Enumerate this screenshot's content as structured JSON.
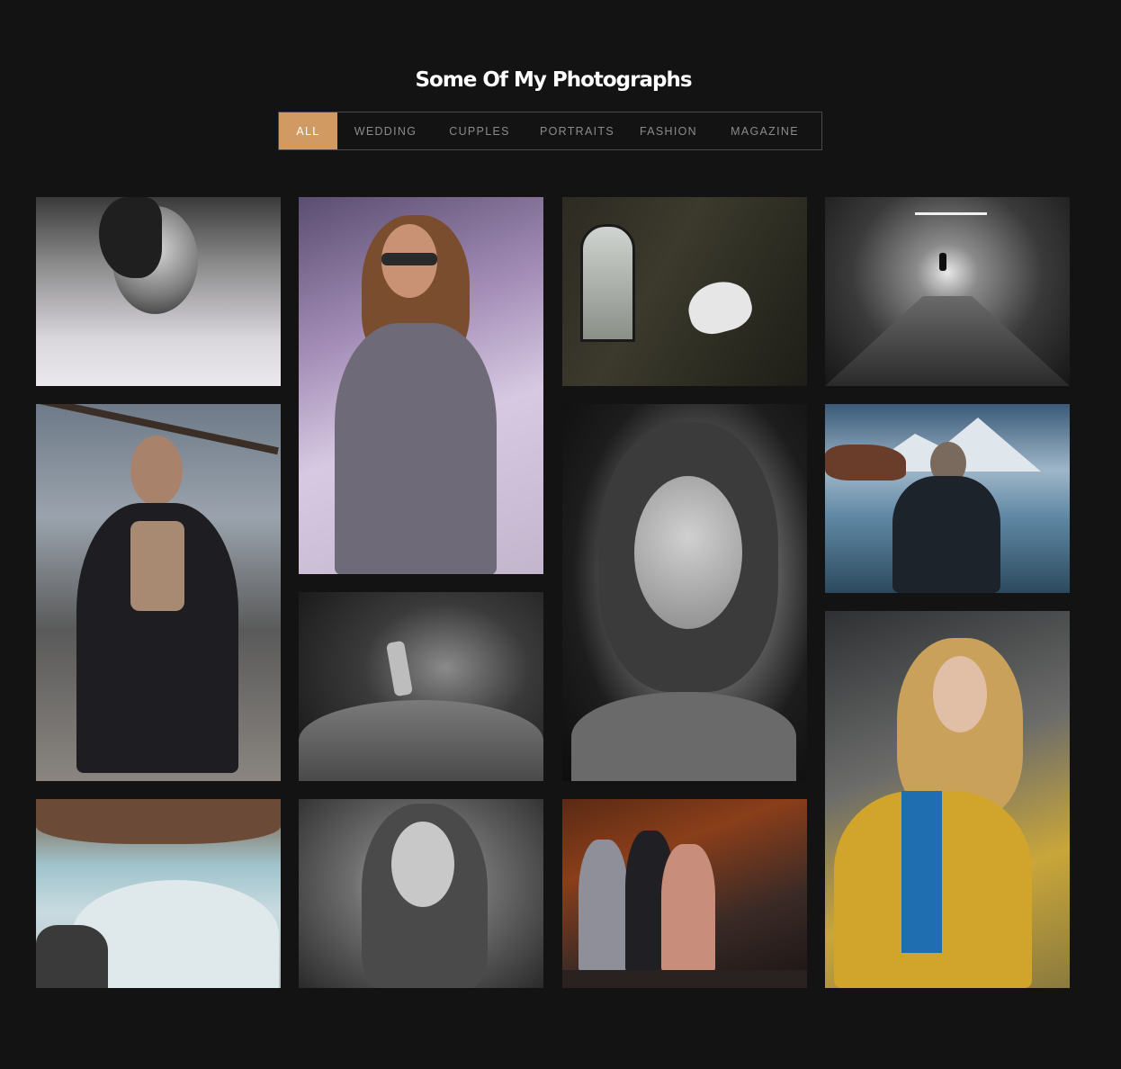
{
  "header": {
    "title": "Some Of My Photographs"
  },
  "filters": [
    {
      "label": "ALL",
      "active": true
    },
    {
      "label": "WEDDING",
      "active": false
    },
    {
      "label": "CUPPLES",
      "active": false
    },
    {
      "label": "PORTRAITS",
      "active": false
    },
    {
      "label": "FASHION",
      "active": false
    },
    {
      "label": "MAGAZINE",
      "active": false
    }
  ],
  "colors": {
    "background": "#131313",
    "accent": "#d09a62",
    "filter_text": "#8b8b8b"
  },
  "gallery": {
    "photos": [
      {
        "subject": "woman-portrait-bw"
      },
      {
        "subject": "woman-sunglasses"
      },
      {
        "subject": "dancer-window"
      },
      {
        "subject": "tunnel-figure"
      },
      {
        "subject": "bearded-man-coat"
      },
      {
        "subject": "woman-portrait-bw-closeup"
      },
      {
        "subject": "man-lake-mountains"
      },
      {
        "subject": "runner-dark-path"
      },
      {
        "subject": "woman-yellow-coat"
      },
      {
        "subject": "bride-tree-shore"
      },
      {
        "subject": "woman-long-hair-bw"
      },
      {
        "subject": "three-women-autumn"
      }
    ]
  }
}
